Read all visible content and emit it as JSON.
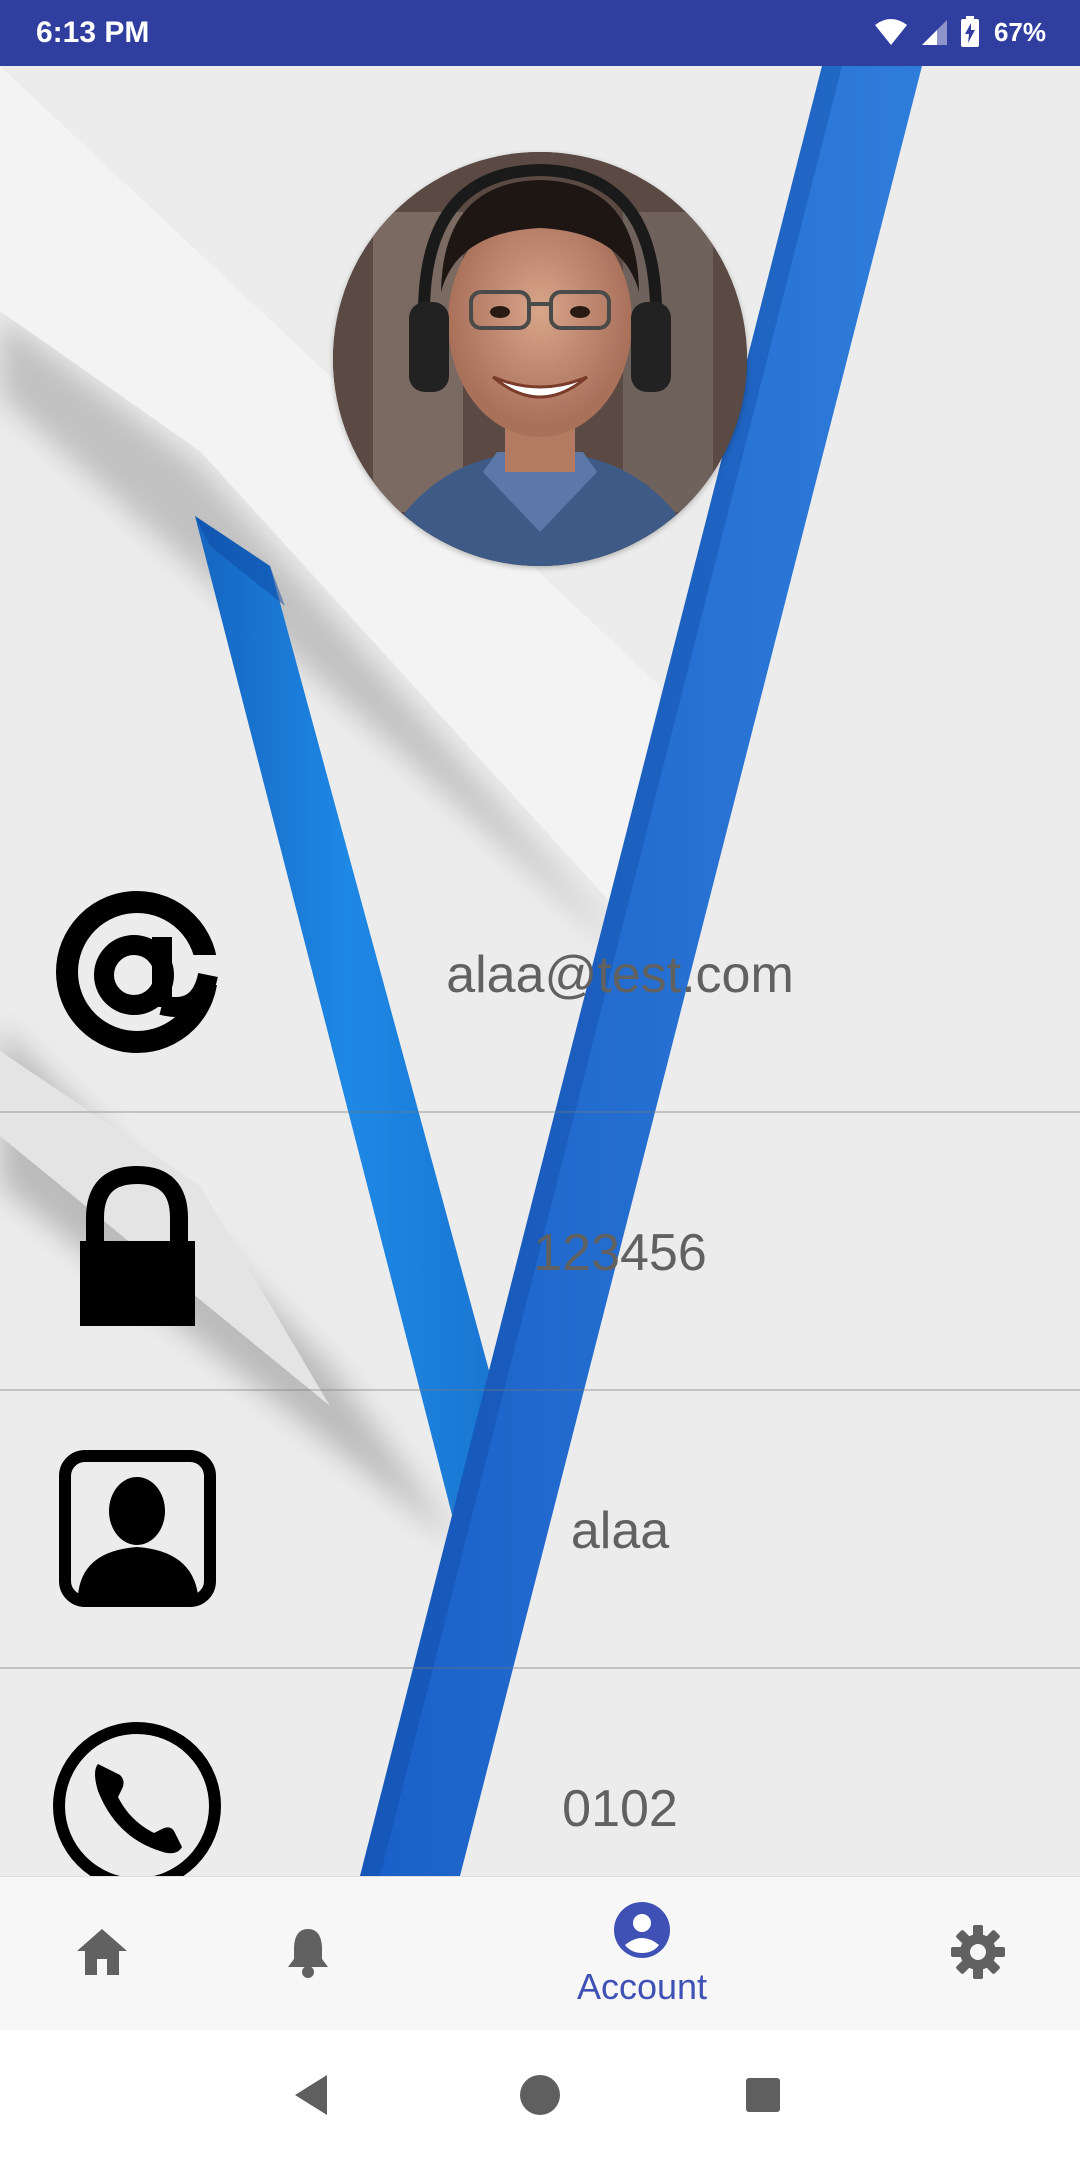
{
  "status_bar": {
    "time": "6:13 PM",
    "battery": "67%",
    "icons": [
      "wifi-icon",
      "cell-signal-icon",
      "battery-charging-icon"
    ]
  },
  "profile": {
    "avatar_icon": "profile-photo"
  },
  "fields": [
    {
      "icon": "at-sign-icon",
      "value": "alaa@test.com"
    },
    {
      "icon": "lock-icon",
      "value": "123456"
    },
    {
      "icon": "contact-card-icon",
      "value": "alaa"
    },
    {
      "icon": "phone-icon",
      "value": "0102"
    }
  ],
  "bottom_nav": {
    "items": [
      {
        "icon": "home-icon",
        "label": ""
      },
      {
        "icon": "bell-icon",
        "label": ""
      },
      {
        "icon": "account-icon",
        "label": "Account",
        "selected": true
      },
      {
        "icon": "gear-icon",
        "label": ""
      }
    ]
  },
  "system_nav": [
    "back-icon",
    "home-circle-icon",
    "recents-icon"
  ],
  "colors": {
    "status_bar": "#303f9f",
    "accent": "#3f51b5",
    "stripe_blue": "#1e7fd8",
    "value_text": "#616161"
  }
}
